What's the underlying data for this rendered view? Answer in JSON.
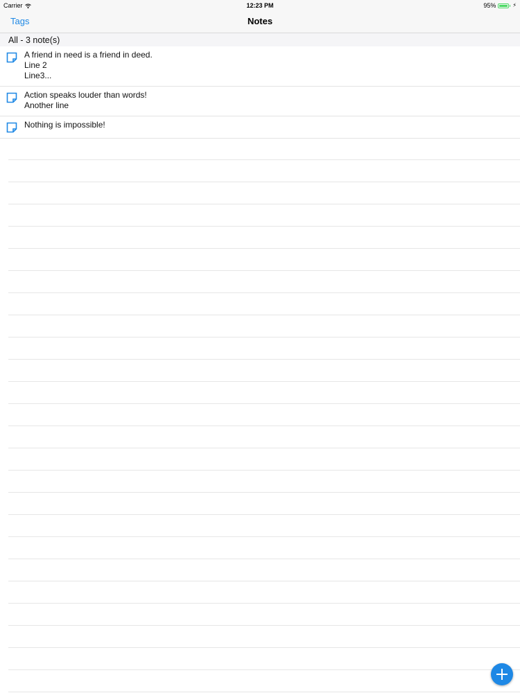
{
  "status_bar": {
    "carrier": "Carrier",
    "time": "12:23 PM",
    "battery_text": "95%",
    "battery_level": 0.95,
    "icons": [
      "wifi-icon",
      "battery-icon",
      "charging-icon"
    ]
  },
  "nav": {
    "back_label": "Tags",
    "title": "Notes"
  },
  "section": {
    "header": "All - 3 note(s)"
  },
  "notes": [
    {
      "text": "A friend in need is a friend in deed.\nLine 2\nLine3..."
    },
    {
      "text": "Action speaks louder than words!\nAnother line"
    },
    {
      "text": "Nothing is impossible!"
    }
  ],
  "fab": {
    "icon": "plus-icon"
  },
  "colors": {
    "accent": "#1e88e5",
    "battery": "#4cd964"
  }
}
